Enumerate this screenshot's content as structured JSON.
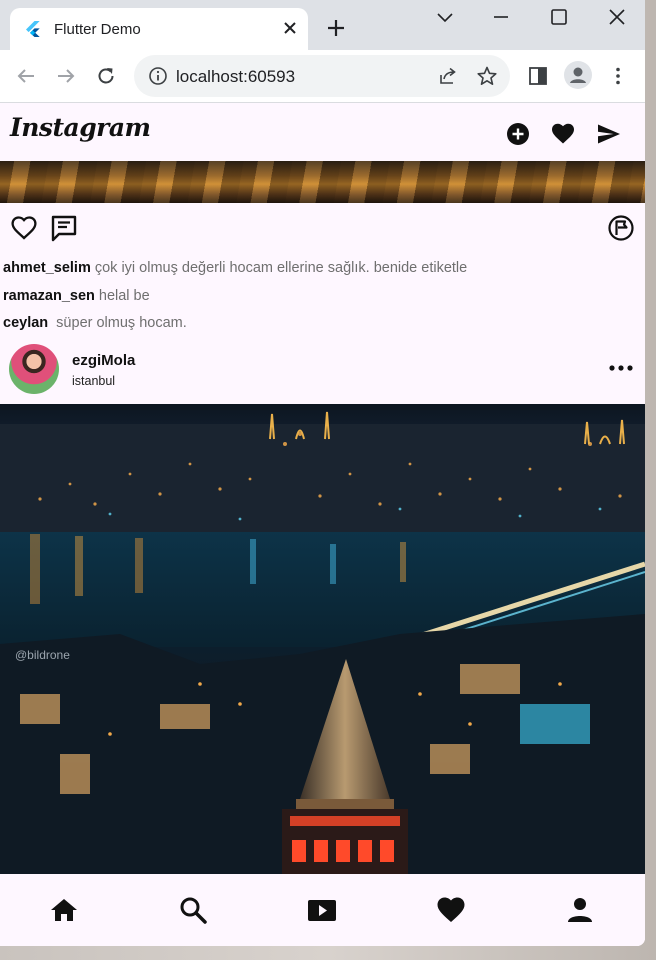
{
  "browser": {
    "tab_title": "Flutter Demo",
    "url": "localhost:60593"
  },
  "app": {
    "logo": "Instagram",
    "comments": [
      {
        "user": "ahmet_selim",
        "text": "çok iyi olmuş değerli hocam ellerine sağlık. benide etiketle"
      },
      {
        "user": "ramazan_sen",
        "text": "helal be"
      },
      {
        "user": "ceylan",
        "text": " süper olmuş hocam."
      }
    ],
    "post": {
      "username": "ezgiMola",
      "location": "istanbul",
      "watermark": "@bildrone"
    },
    "icons": {
      "appbar": [
        "add-circle-icon",
        "heart-icon",
        "send-icon"
      ],
      "actions": [
        "heart-outline-icon",
        "comment-icon",
        "flag-icon"
      ],
      "bottom_nav": [
        "home-icon",
        "search-icon",
        "play-icon",
        "heart-icon",
        "person-icon"
      ]
    }
  },
  "colors": {
    "app_background": "#fef7ff",
    "tabstrip": "#dee1e6",
    "icon": "#111111"
  }
}
